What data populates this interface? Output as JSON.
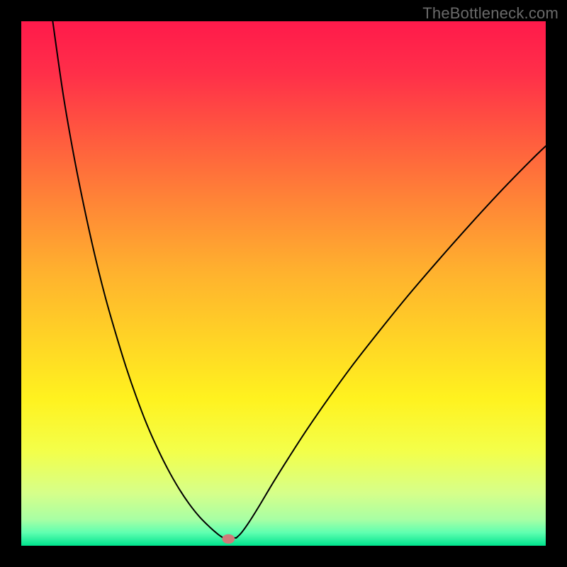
{
  "watermark": "TheBottleneck.com",
  "chart_data": {
    "type": "line",
    "title": "",
    "xlabel": "",
    "ylabel": "",
    "xlim": [
      0,
      1
    ],
    "ylim": [
      0,
      1
    ],
    "grid": false,
    "legend": false,
    "background": {
      "type": "vertical_gradient",
      "stops": [
        {
          "offset": 0.0,
          "color": "#ff1a4b"
        },
        {
          "offset": 0.1,
          "color": "#ff2f49"
        },
        {
          "offset": 0.22,
          "color": "#ff5a3f"
        },
        {
          "offset": 0.35,
          "color": "#ff8736"
        },
        {
          "offset": 0.48,
          "color": "#ffb22e"
        },
        {
          "offset": 0.6,
          "color": "#ffd226"
        },
        {
          "offset": 0.72,
          "color": "#fff21f"
        },
        {
          "offset": 0.82,
          "color": "#f3ff4a"
        },
        {
          "offset": 0.9,
          "color": "#d6ff8a"
        },
        {
          "offset": 0.95,
          "color": "#a8ffa4"
        },
        {
          "offset": 0.975,
          "color": "#5fffb0"
        },
        {
          "offset": 1.0,
          "color": "#00e38e"
        }
      ]
    },
    "marker": {
      "x": 0.395,
      "y": 0.987,
      "color": "#d07a7a",
      "rx": 0.012,
      "ry": 0.009
    },
    "series": [
      {
        "name": "left_curve",
        "stroke": "#000000",
        "stroke_width": 2,
        "points": [
          {
            "x": 0.06,
            "y": 0.0
          },
          {
            "x": 0.08,
            "y": 0.14
          },
          {
            "x": 0.1,
            "y": 0.255
          },
          {
            "x": 0.12,
            "y": 0.355
          },
          {
            "x": 0.14,
            "y": 0.445
          },
          {
            "x": 0.16,
            "y": 0.525
          },
          {
            "x": 0.18,
            "y": 0.595
          },
          {
            "x": 0.2,
            "y": 0.66
          },
          {
            "x": 0.22,
            "y": 0.718
          },
          {
            "x": 0.24,
            "y": 0.77
          },
          {
            "x": 0.26,
            "y": 0.815
          },
          {
            "x": 0.28,
            "y": 0.855
          },
          {
            "x": 0.3,
            "y": 0.89
          },
          {
            "x": 0.32,
            "y": 0.92
          },
          {
            "x": 0.34,
            "y": 0.945
          },
          {
            "x": 0.36,
            "y": 0.965
          },
          {
            "x": 0.375,
            "y": 0.978
          },
          {
            "x": 0.385,
            "y": 0.985
          }
        ]
      },
      {
        "name": "flat_segment",
        "stroke": "#000000",
        "stroke_width": 2,
        "points": [
          {
            "x": 0.385,
            "y": 0.985
          },
          {
            "x": 0.41,
            "y": 0.985
          }
        ]
      },
      {
        "name": "right_curve",
        "stroke": "#000000",
        "stroke_width": 2,
        "points": [
          {
            "x": 0.41,
            "y": 0.985
          },
          {
            "x": 0.42,
            "y": 0.975
          },
          {
            "x": 0.435,
            "y": 0.954
          },
          {
            "x": 0.455,
            "y": 0.922
          },
          {
            "x": 0.48,
            "y": 0.88
          },
          {
            "x": 0.51,
            "y": 0.832
          },
          {
            "x": 0.545,
            "y": 0.778
          },
          {
            "x": 0.585,
            "y": 0.72
          },
          {
            "x": 0.63,
            "y": 0.658
          },
          {
            "x": 0.68,
            "y": 0.594
          },
          {
            "x": 0.735,
            "y": 0.526
          },
          {
            "x": 0.795,
            "y": 0.456
          },
          {
            "x": 0.858,
            "y": 0.385
          },
          {
            "x": 0.92,
            "y": 0.318
          },
          {
            "x": 0.975,
            "y": 0.262
          },
          {
            "x": 1.0,
            "y": 0.238
          }
        ]
      }
    ]
  }
}
